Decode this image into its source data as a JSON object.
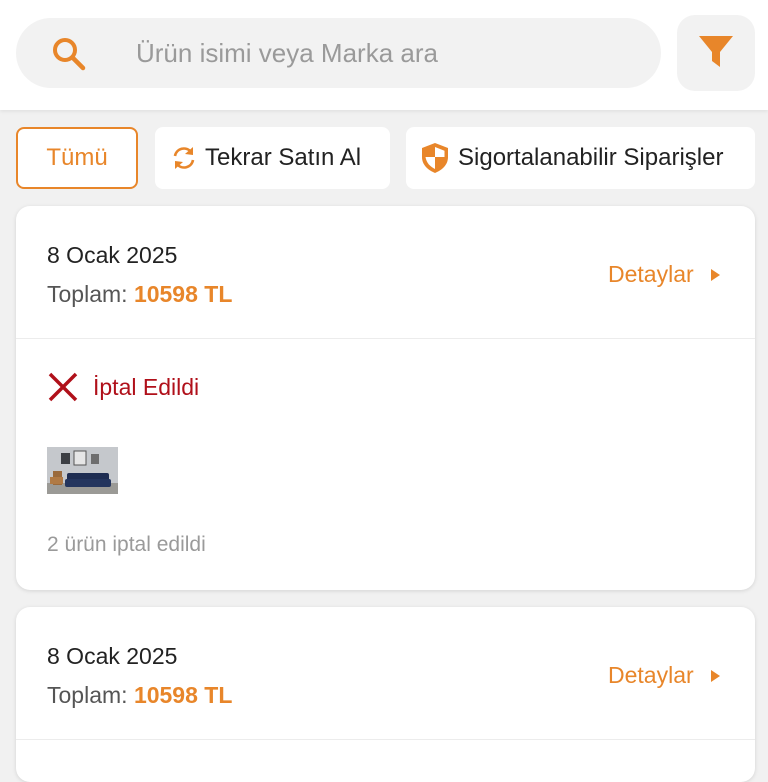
{
  "search": {
    "placeholder": "Ürün isimi veya Marka ara",
    "icon": "search-icon"
  },
  "filter": {
    "icon": "filter-icon"
  },
  "chips": {
    "all": "Tümü",
    "rebuy": "Tekrar Satın Al",
    "insurable": "Sigortalanabilir Siparişler"
  },
  "colors": {
    "accent": "#e8862a",
    "cancelled": "#b0101a"
  },
  "orders": [
    {
      "date": "8 Ocak 2025",
      "total_label": "Toplam:",
      "total_amount": "10598 TL",
      "details_label": "Detaylar",
      "status": "İptal Edildi",
      "note": "2 ürün iptal edildi"
    },
    {
      "date": "8 Ocak 2025",
      "total_label": "Toplam:",
      "total_amount": "10598 TL",
      "details_label": "Detaylar"
    }
  ]
}
